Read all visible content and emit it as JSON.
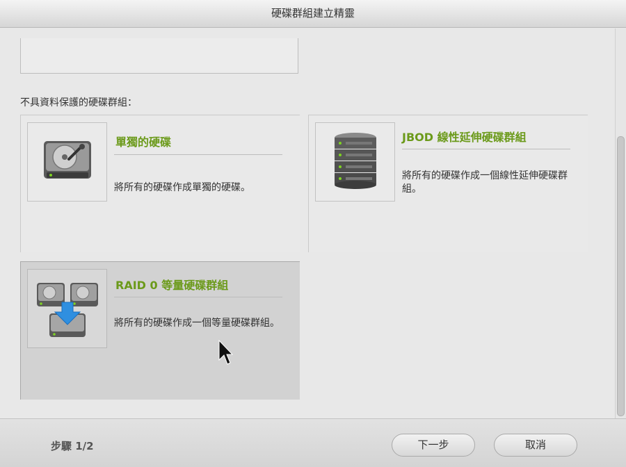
{
  "window": {
    "title": "硬碟群組建立精靈"
  },
  "section": {
    "label": "不具資料保護的硬碟群組："
  },
  "options": [
    {
      "title": "單獨的硬碟",
      "description": "將所有的硬碟作成單獨的硬碟。",
      "icon": "single-hdd-icon",
      "selected": false
    },
    {
      "title": "JBOD 線性延伸硬碟群組",
      "description": "將所有的硬碟作成一個線性延伸硬碟群組。",
      "icon": "server-stack-icon",
      "selected": false
    },
    {
      "title": "RAID 0 等量硬碟群組",
      "description": "將所有的硬碟作成一個等量硬碟群組。",
      "icon": "raid0-hdd-icon",
      "selected": true
    }
  ],
  "footer": {
    "step": "步驟 1/2",
    "next_label": "下一步",
    "cancel_label": "取消"
  },
  "colors": {
    "title_green": "#6b9a1a",
    "selected_bg": "#d2d2d2"
  }
}
